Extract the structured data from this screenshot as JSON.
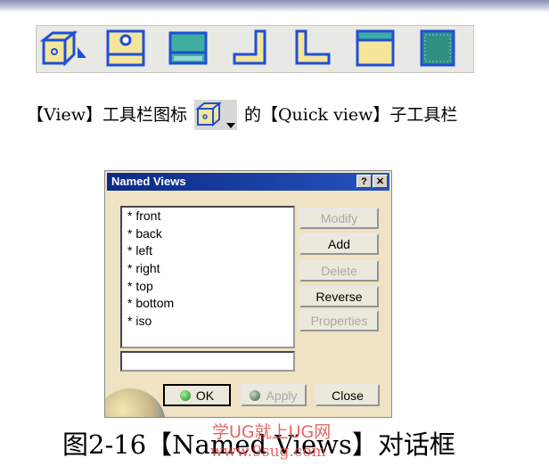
{
  "caption_top": {
    "prefix": "【View】工具栏图标",
    "suffix": "的【Quick view】子工具栏"
  },
  "toolbar_icons": [
    "isometric-view-icon",
    "front-view-icon",
    "top-view-icon",
    "left-view-icon",
    "right-view-icon",
    "bottom-view-icon",
    "back-view-icon"
  ],
  "dialog": {
    "title": "Named Views",
    "help_glyph": "?",
    "close_glyph": "✕",
    "views": [
      "* front",
      "* back",
      "* left",
      "* right",
      "* top",
      "* bottom",
      "* iso"
    ],
    "name_field_value": "",
    "buttons": {
      "modify": "Modify",
      "add": "Add",
      "delete": "Delete",
      "reverse": "Reverse",
      "properties": "Properties",
      "ok": "OK",
      "apply": "Apply",
      "close": "Close"
    }
  },
  "caption_bottom": "图2-16【Named Views】对话框",
  "watermark": {
    "line1": "学UG就上UG网",
    "line2": "www.9sug.com"
  },
  "colors": {
    "dialog_bg": "#efe3c4",
    "titlebar": "#0b2a86",
    "watermark": "#e04a4a",
    "icon_blue": "#1f4fd6",
    "icon_yellow": "#f3e59a"
  }
}
